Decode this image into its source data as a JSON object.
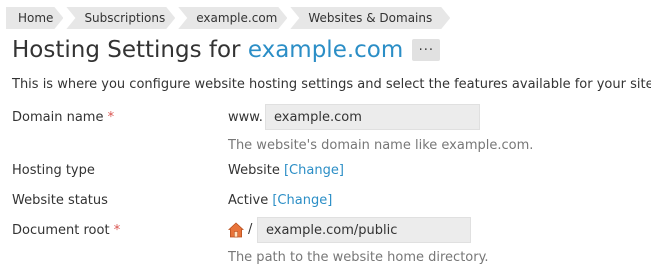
{
  "breadcrumb": [
    "Home",
    "Subscriptions",
    "example.com",
    "Websites & Domains"
  ],
  "header": {
    "title_prefix": "Hosting Settings for",
    "title_domain": "example.com",
    "more_label": "···"
  },
  "intro": "This is where you configure website hosting settings and select the features available for your site.",
  "form": {
    "domain_name": {
      "label": "Domain name",
      "required": "*",
      "prefix": "www.",
      "value": "example.com",
      "hint": "The website's domain name like example.com."
    },
    "hosting_type": {
      "label": "Hosting type",
      "value": "Website",
      "change_link": "[Change]"
    },
    "website_status": {
      "label": "Website status",
      "value": "Active",
      "change_link": "[Change]"
    },
    "document_root": {
      "label": "Document root",
      "required": "*",
      "separator": "/",
      "value": "example.com/public",
      "hint": "The path to the website home directory."
    }
  },
  "colors": {
    "link": "#2b8ec6",
    "required": "#d9534f",
    "field_bg": "#ececec",
    "crumb_bg": "#e7e7e7"
  }
}
